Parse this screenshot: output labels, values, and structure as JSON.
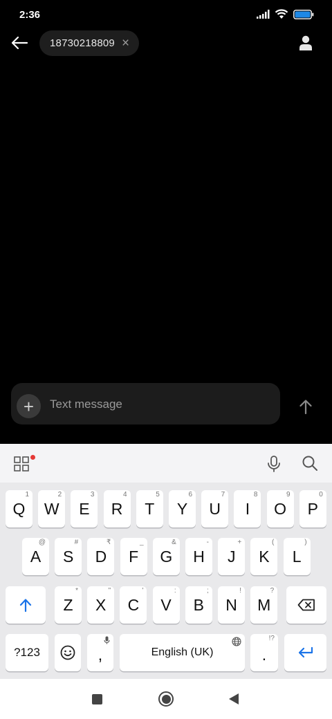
{
  "status_bar": {
    "time": "2:36"
  },
  "top_bar": {
    "recipient": "18730218809",
    "chip_close": "×"
  },
  "composer": {
    "placeholder": "Text message",
    "attach": "+"
  },
  "keyboard": {
    "row1": [
      {
        "label": "Q",
        "hint": "1"
      },
      {
        "label": "W",
        "hint": "2"
      },
      {
        "label": "E",
        "hint": "3"
      },
      {
        "label": "R",
        "hint": "4"
      },
      {
        "label": "T",
        "hint": "5"
      },
      {
        "label": "Y",
        "hint": "6"
      },
      {
        "label": "U",
        "hint": "7"
      },
      {
        "label": "I",
        "hint": "8"
      },
      {
        "label": "O",
        "hint": "9"
      },
      {
        "label": "P",
        "hint": "0"
      }
    ],
    "row2": [
      {
        "label": "A",
        "hint": "@"
      },
      {
        "label": "S",
        "hint": "#"
      },
      {
        "label": "D",
        "hint": "₹"
      },
      {
        "label": "F",
        "hint": "_"
      },
      {
        "label": "G",
        "hint": "&"
      },
      {
        "label": "H",
        "hint": "-"
      },
      {
        "label": "J",
        "hint": "+"
      },
      {
        "label": "K",
        "hint": "("
      },
      {
        "label": "L",
        "hint": ")"
      }
    ],
    "row3": [
      {
        "label": "Z",
        "hint": "*"
      },
      {
        "label": "X",
        "hint": "\""
      },
      {
        "label": "C",
        "hint": "'"
      },
      {
        "label": "V",
        "hint": ":"
      },
      {
        "label": "B",
        "hint": ";"
      },
      {
        "label": "N",
        "hint": "!"
      },
      {
        "label": "M",
        "hint": "?"
      }
    ],
    "symbols_label": "?123",
    "comma_label": ",",
    "space_label": "English (UK)",
    "period_label": ".",
    "period_hint": "!?"
  },
  "colors": {
    "accent": "#1a73e8",
    "badge": "#e53935",
    "keyboard_bg": "#e9e9eb"
  }
}
